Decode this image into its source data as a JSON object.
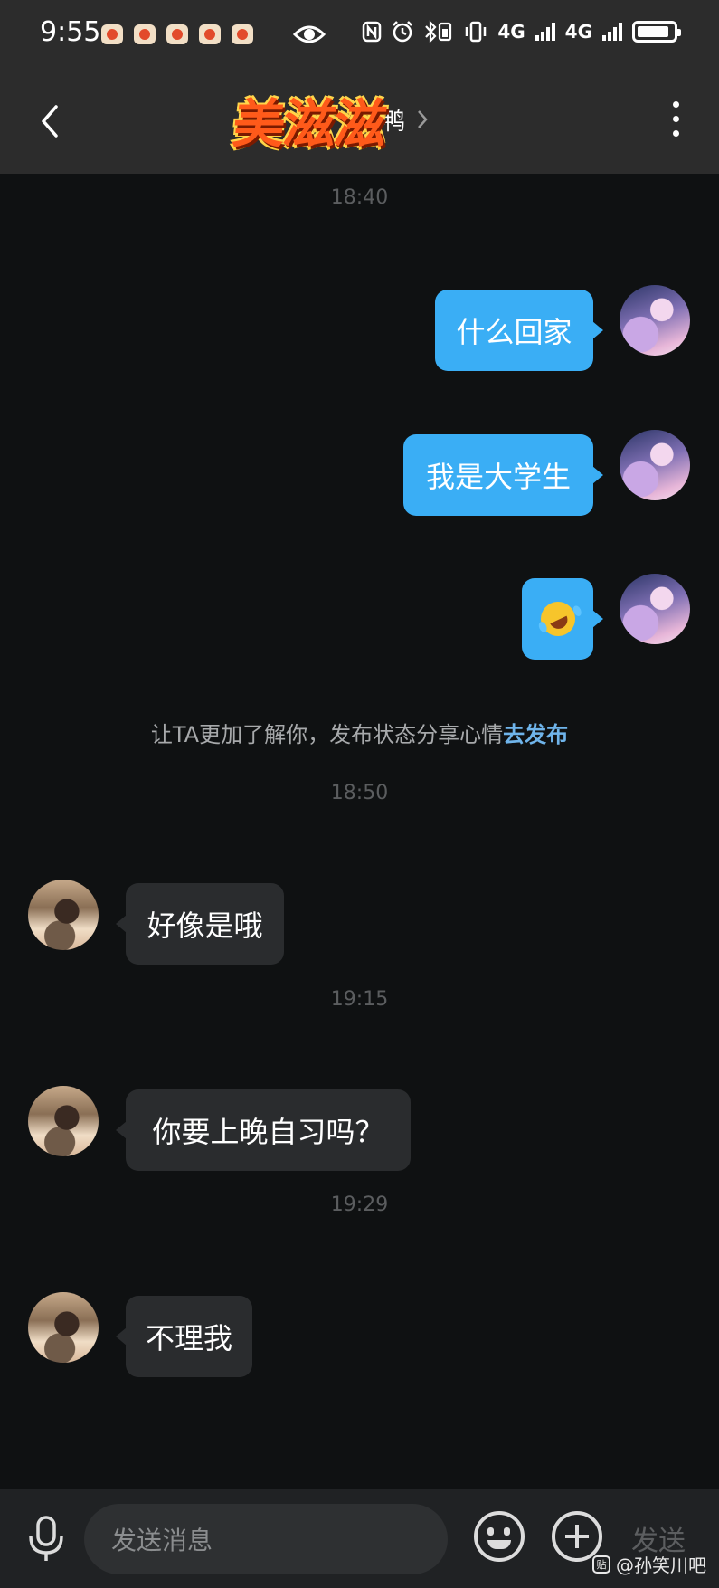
{
  "status_bar": {
    "time": "9:55",
    "notification_icons": [
      "tomato-app-icon",
      "tomato-app-icon",
      "tomato-app-icon",
      "tomato-app-icon",
      "tomato-app-icon"
    ],
    "network_1": "4G",
    "network_2": "4G"
  },
  "header": {
    "logo_text": "美滋滋",
    "title_tail": "鸭"
  },
  "messages": {
    "ts1": "18:40",
    "m1": "什么回家",
    "m2": "我是大学生",
    "m3_emoji": "rolling-laughing-emoji",
    "tip_text": "让TA更加了解你，发布状态分享心情",
    "tip_link": "去发布",
    "ts2": "18:50",
    "m4": "好像是哦",
    "ts3": "19:15",
    "m5": "你要上晚自习吗？",
    "ts4": "19:29",
    "m6": "不理我"
  },
  "input_bar": {
    "placeholder": "发送消息",
    "send_label": "发送"
  },
  "watermark": {
    "icon_text": "贴",
    "text": "@孙笑川吧"
  },
  "colors": {
    "my_bubble": "#3aaef5",
    "their_bubble": "#2a2c2e",
    "background": "#0f1112",
    "link": "#6fb4ea"
  }
}
